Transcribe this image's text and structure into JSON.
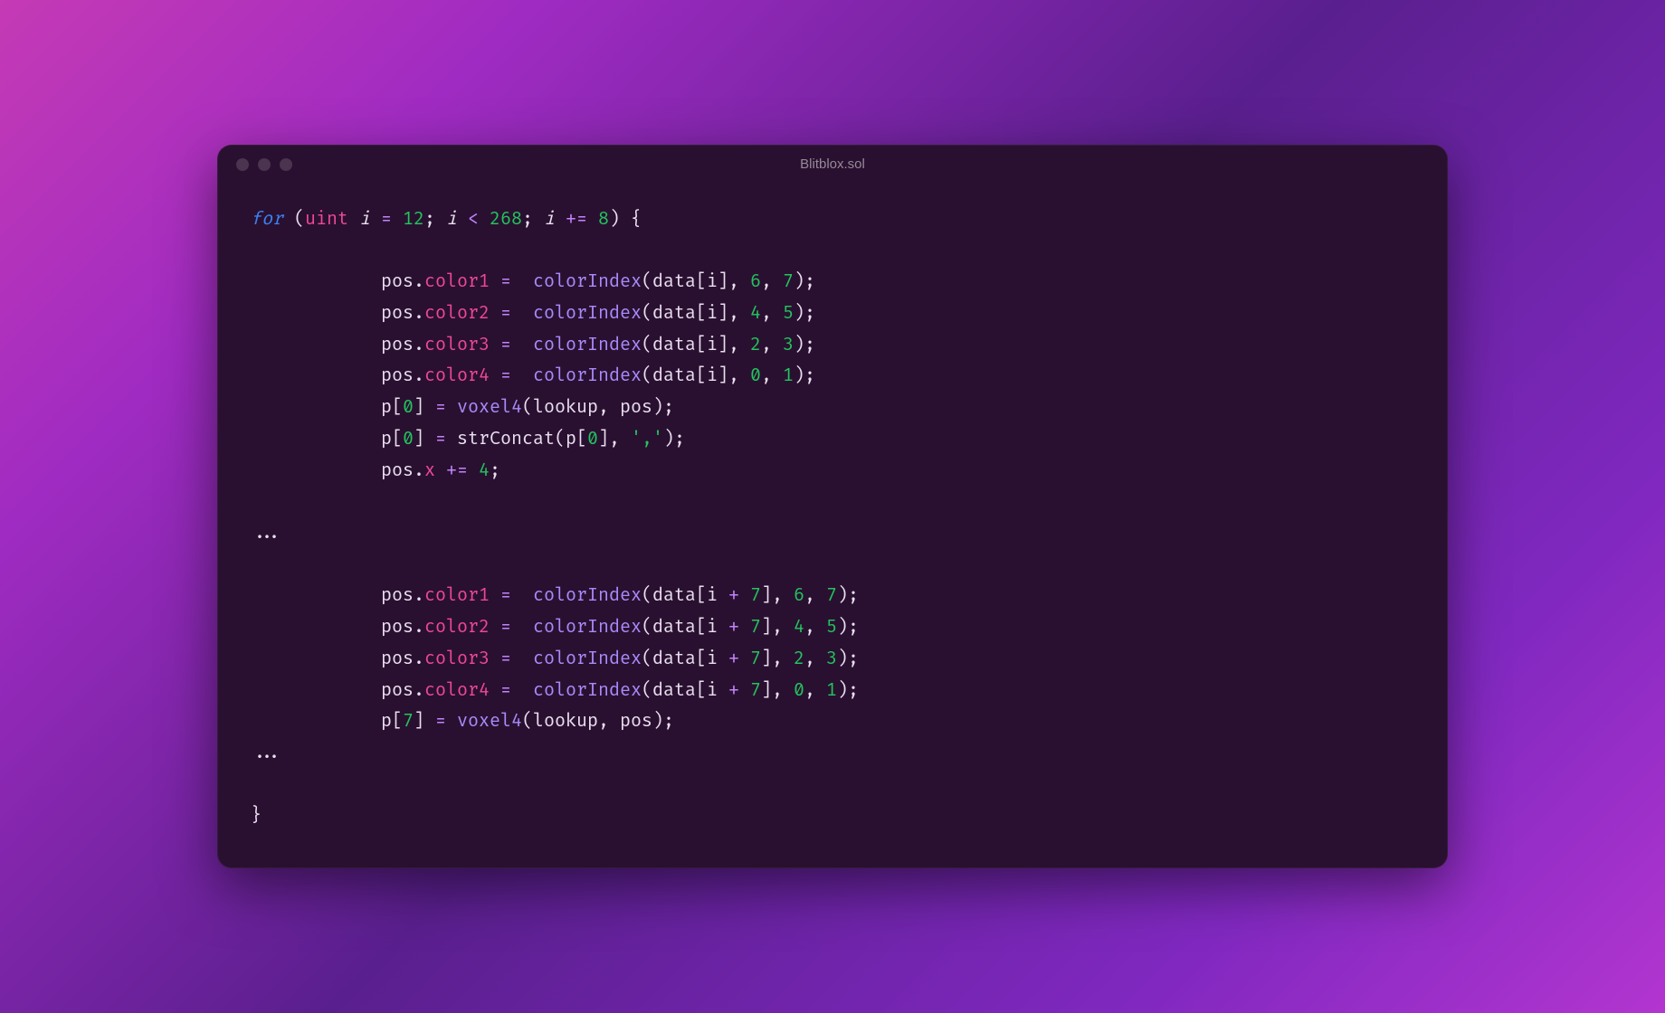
{
  "window": {
    "title": "Blitblox.sol"
  },
  "code": {
    "for": "for",
    "uint": "uint",
    "i": "i",
    "eq": "=",
    "n12": "12",
    "lt": "<",
    "n268": "268",
    "pluseq": "+=",
    "n8": "8",
    "lbrace": "{",
    "rbrace": "}",
    "pos": "pos",
    "dot": ".",
    "color1": "color1",
    "color2": "color2",
    "color3": "color3",
    "color4": "color4",
    "colorIndex": "colorIndex",
    "lparen": "(",
    "rparen": ")",
    "data": "data",
    "lbracket": "[",
    "rbracket": "]",
    "comma": ",",
    "n6": "6",
    "n7": "7",
    "n4": "4",
    "n5": "5",
    "n2": "2",
    "n3": "3",
    "n0": "0",
    "n1": "1",
    "semi": ";",
    "p": "p",
    "voxel4": "voxel4",
    "lookup": "lookup",
    "strConcat": "strConcat",
    "strComma": "','",
    "x": "x",
    "plus": "+",
    "dots": "...",
    "iPlus7": "i + 7"
  }
}
